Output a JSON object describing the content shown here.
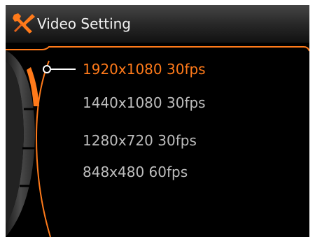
{
  "header": {
    "icon": "tools-icon",
    "title": "Video Setting"
  },
  "colors": {
    "accent": "#ff7a1a",
    "text": "#bdbdbd",
    "background": "#000000"
  },
  "options": [
    {
      "label": "1920x1080 30fps",
      "selected": true
    },
    {
      "label": "1440x1080 30fps",
      "selected": false
    },
    {
      "label": "1280x720 30fps",
      "selected": false
    },
    {
      "label": "848x480 60fps",
      "selected": false
    }
  ]
}
